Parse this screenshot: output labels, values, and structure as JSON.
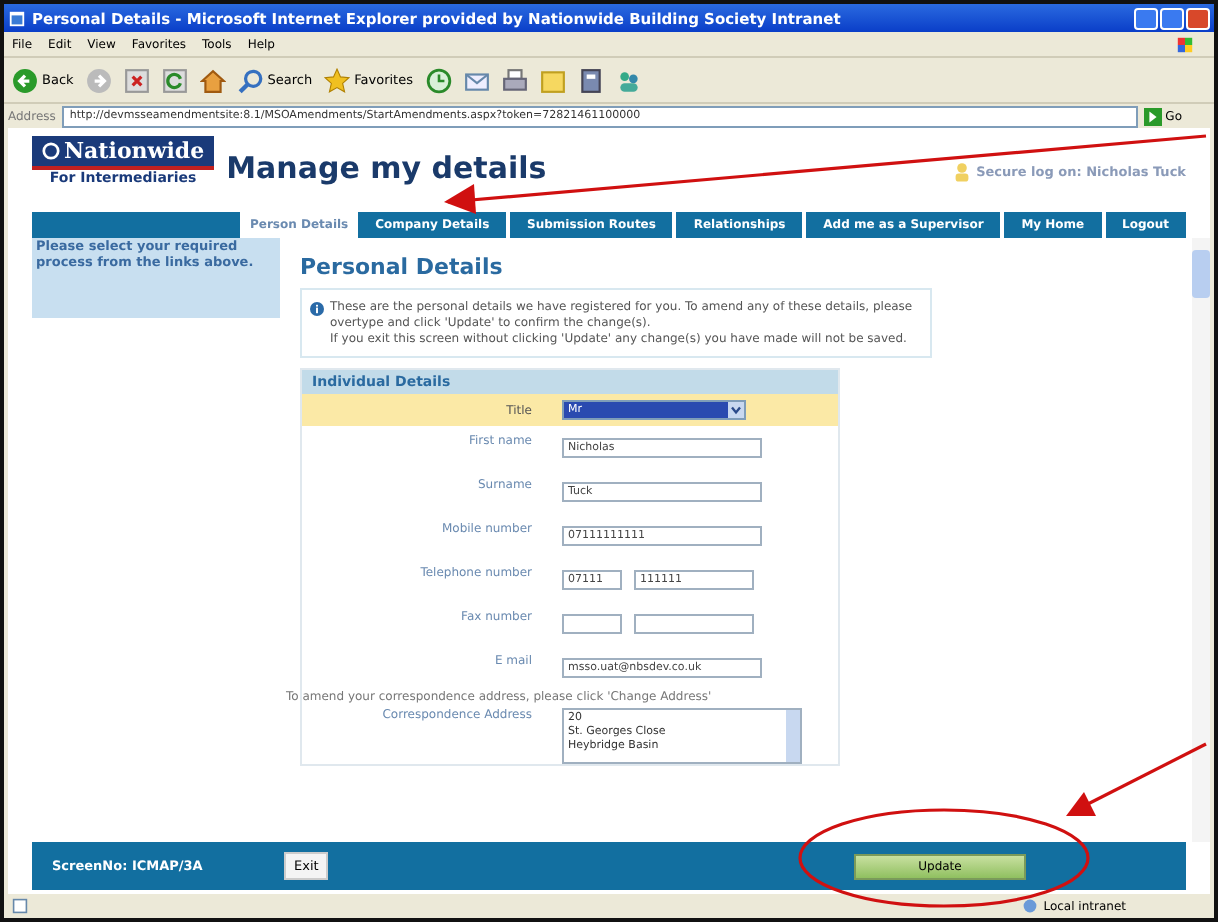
{
  "window": {
    "title": "Personal Details - Microsoft Internet Explorer provided by Nationwide Building Society Intranet"
  },
  "menu": [
    "File",
    "Edit",
    "View",
    "Favorites",
    "Tools",
    "Help"
  ],
  "toolbar": {
    "back": "Back",
    "search": "Search",
    "favorites": "Favorites"
  },
  "address_bar": {
    "label": "Address",
    "url": "http://devmsseamendmentsite:8.1/MSOAmendments/StartAmendments.aspx?token=72821461100000",
    "go": "Go"
  },
  "header": {
    "logo_name": "Nationwide",
    "logo_sub": "For Intermediaries",
    "page_title": "Manage my details",
    "secure_log": "Secure log on: Nicholas Tuck"
  },
  "tabs": [
    {
      "label": "Person Details",
      "selected": true
    },
    {
      "label": "Company Details",
      "selected": false
    },
    {
      "label": "Submission Routes",
      "selected": false
    },
    {
      "label": "Relationships",
      "selected": false
    },
    {
      "label": "Add me as a Supervisor",
      "selected": false
    },
    {
      "label": "My Home",
      "selected": false
    },
    {
      "label": "Logout",
      "selected": false
    }
  ],
  "sidebar": {
    "text": "Please select your required process from the links above."
  },
  "section_title": "Personal Details",
  "info": [
    "These are the personal details we have registered for you. To amend any of these details, please overtype and click 'Update' to confirm the change(s).",
    "If you exit this screen without clicking 'Update' any change(s) you have made will not be saved."
  ],
  "panel": {
    "title": "Individual Details",
    "fields": [
      {
        "kind": "select",
        "label": "Title",
        "value": "Mr"
      },
      {
        "kind": "text",
        "label": "First name",
        "value": "Nicholas"
      },
      {
        "kind": "text",
        "label": "Surname",
        "value": "Tuck"
      },
      {
        "kind": "text",
        "label": "Mobile number",
        "value": "07111111111"
      },
      {
        "kind": "split",
        "label": "Telephone number",
        "values": [
          "07111",
          "111111"
        ]
      },
      {
        "kind": "split",
        "label": "Fax number"
      },
      {
        "kind": "text",
        "label": "E mail",
        "value": "msso.uat@nbsdev.co.uk"
      }
    ],
    "address_note": "To amend your correspondence address, please click 'Change Address'",
    "address_label": "Correspondence Address",
    "address_lines": [
      "20",
      "St. Georges Close",
      "Heybridge Basin"
    ]
  },
  "footer": {
    "screen_no": "ScreenNo: ICMAP/3A",
    "exit": "Exit",
    "update": "Update"
  },
  "status_bar": {
    "zone": "Local intranet"
  }
}
